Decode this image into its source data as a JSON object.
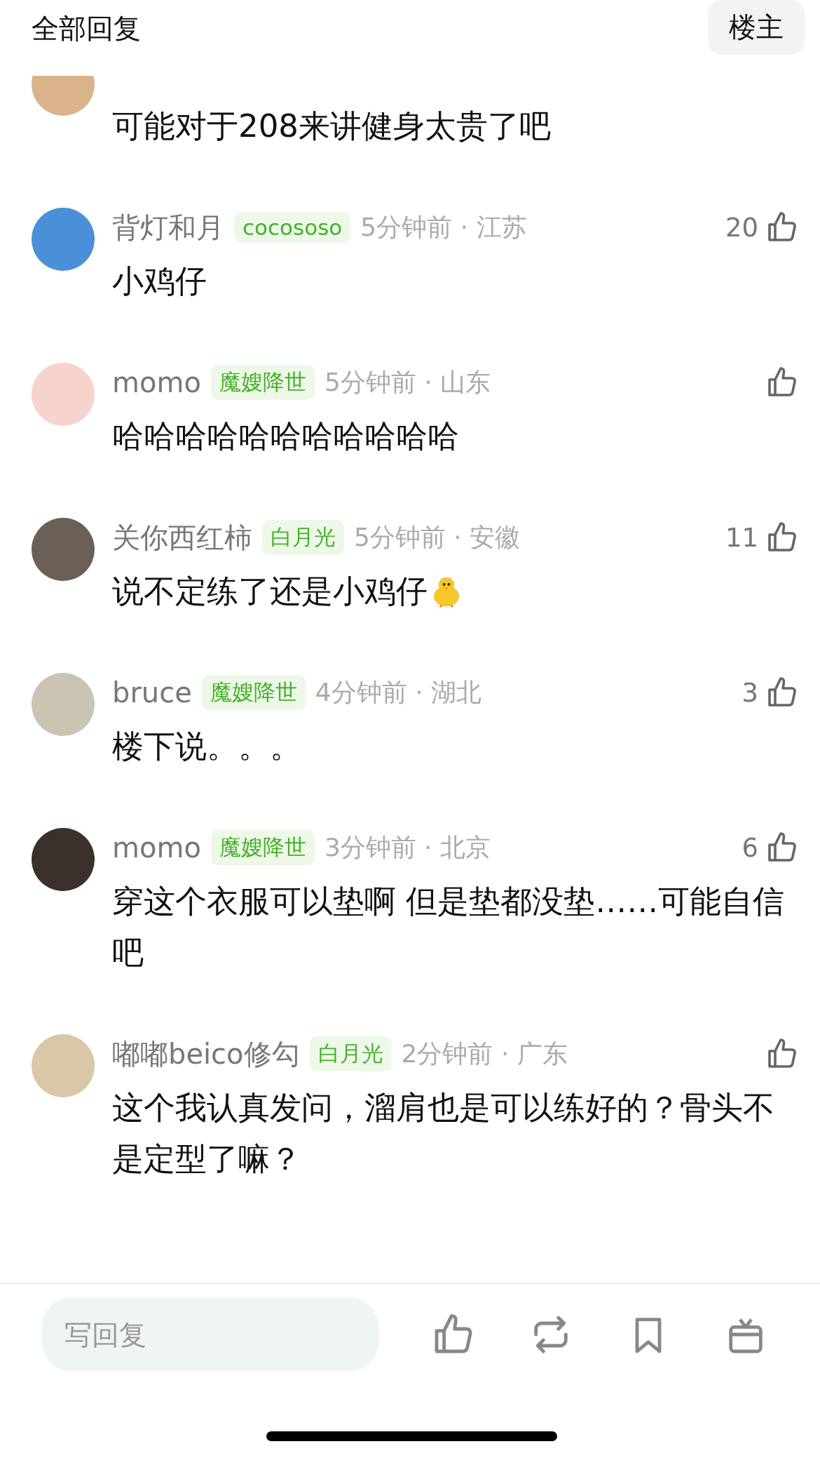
{
  "header": {
    "title": "全部回复",
    "filter_button": "楼主"
  },
  "comments": [
    {
      "text": "可能对于208来讲健身太贵了吧"
    },
    {
      "name": "背灯和月",
      "badge": "cocososo",
      "time": "5分钟前 · 江苏",
      "likes": "20",
      "text": "小鸡仔"
    },
    {
      "name": "momo",
      "badge": "魔嫂降世",
      "time": "5分钟前 · 山东",
      "text": "哈哈哈哈哈哈哈哈哈哈哈"
    },
    {
      "name": "关你西红柿",
      "badge": "白月光",
      "time": "5分钟前 · 安徽",
      "likes": "11",
      "text": "说不定练了还是小鸡仔",
      "sticker": true
    },
    {
      "name": "bruce",
      "badge": "魔嫂降世",
      "time": "4分钟前 · 湖北",
      "likes": "3",
      "text": "楼下说。。。"
    },
    {
      "name": "momo",
      "badge": "魔嫂降世",
      "time": "3分钟前 · 北京",
      "likes": "6",
      "text": "穿这个衣服可以垫啊 但是垫都没垫……可能自信吧"
    },
    {
      "name": "嘟嘟beico修勾",
      "badge": "白月光",
      "time": "2分钟前 · 广东",
      "text": "这个我认真发问，溜肩也是可以练好的？骨头不是定型了嘛？"
    }
  ],
  "reply_bar": {
    "placeholder": "写回复"
  }
}
